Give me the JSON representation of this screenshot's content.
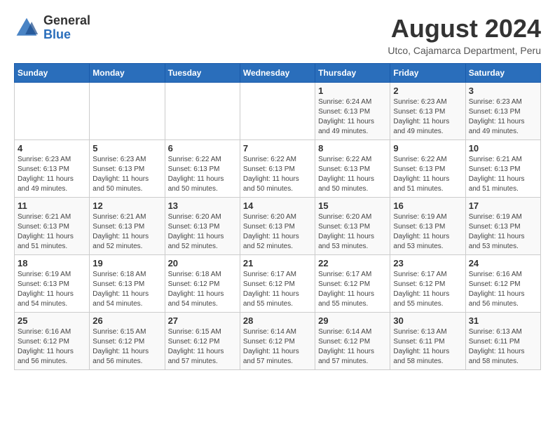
{
  "logo": {
    "general": "General",
    "blue": "Blue"
  },
  "title": "August 2024",
  "subtitle": "Utco, Cajamarca Department, Peru",
  "weekdays": [
    "Sunday",
    "Monday",
    "Tuesday",
    "Wednesday",
    "Thursday",
    "Friday",
    "Saturday"
  ],
  "weeks": [
    [
      {
        "day": "",
        "info": ""
      },
      {
        "day": "",
        "info": ""
      },
      {
        "day": "",
        "info": ""
      },
      {
        "day": "",
        "info": ""
      },
      {
        "day": "1",
        "info": "Sunrise: 6:24 AM\nSunset: 6:13 PM\nDaylight: 11 hours\nand 49 minutes."
      },
      {
        "day": "2",
        "info": "Sunrise: 6:23 AM\nSunset: 6:13 PM\nDaylight: 11 hours\nand 49 minutes."
      },
      {
        "day": "3",
        "info": "Sunrise: 6:23 AM\nSunset: 6:13 PM\nDaylight: 11 hours\nand 49 minutes."
      }
    ],
    [
      {
        "day": "4",
        "info": "Sunrise: 6:23 AM\nSunset: 6:13 PM\nDaylight: 11 hours\nand 49 minutes."
      },
      {
        "day": "5",
        "info": "Sunrise: 6:23 AM\nSunset: 6:13 PM\nDaylight: 11 hours\nand 50 minutes."
      },
      {
        "day": "6",
        "info": "Sunrise: 6:22 AM\nSunset: 6:13 PM\nDaylight: 11 hours\nand 50 minutes."
      },
      {
        "day": "7",
        "info": "Sunrise: 6:22 AM\nSunset: 6:13 PM\nDaylight: 11 hours\nand 50 minutes."
      },
      {
        "day": "8",
        "info": "Sunrise: 6:22 AM\nSunset: 6:13 PM\nDaylight: 11 hours\nand 50 minutes."
      },
      {
        "day": "9",
        "info": "Sunrise: 6:22 AM\nSunset: 6:13 PM\nDaylight: 11 hours\nand 51 minutes."
      },
      {
        "day": "10",
        "info": "Sunrise: 6:21 AM\nSunset: 6:13 PM\nDaylight: 11 hours\nand 51 minutes."
      }
    ],
    [
      {
        "day": "11",
        "info": "Sunrise: 6:21 AM\nSunset: 6:13 PM\nDaylight: 11 hours\nand 51 minutes."
      },
      {
        "day": "12",
        "info": "Sunrise: 6:21 AM\nSunset: 6:13 PM\nDaylight: 11 hours\nand 52 minutes."
      },
      {
        "day": "13",
        "info": "Sunrise: 6:20 AM\nSunset: 6:13 PM\nDaylight: 11 hours\nand 52 minutes."
      },
      {
        "day": "14",
        "info": "Sunrise: 6:20 AM\nSunset: 6:13 PM\nDaylight: 11 hours\nand 52 minutes."
      },
      {
        "day": "15",
        "info": "Sunrise: 6:20 AM\nSunset: 6:13 PM\nDaylight: 11 hours\nand 53 minutes."
      },
      {
        "day": "16",
        "info": "Sunrise: 6:19 AM\nSunset: 6:13 PM\nDaylight: 11 hours\nand 53 minutes."
      },
      {
        "day": "17",
        "info": "Sunrise: 6:19 AM\nSunset: 6:13 PM\nDaylight: 11 hours\nand 53 minutes."
      }
    ],
    [
      {
        "day": "18",
        "info": "Sunrise: 6:19 AM\nSunset: 6:13 PM\nDaylight: 11 hours\nand 54 minutes."
      },
      {
        "day": "19",
        "info": "Sunrise: 6:18 AM\nSunset: 6:13 PM\nDaylight: 11 hours\nand 54 minutes."
      },
      {
        "day": "20",
        "info": "Sunrise: 6:18 AM\nSunset: 6:12 PM\nDaylight: 11 hours\nand 54 minutes."
      },
      {
        "day": "21",
        "info": "Sunrise: 6:17 AM\nSunset: 6:12 PM\nDaylight: 11 hours\nand 55 minutes."
      },
      {
        "day": "22",
        "info": "Sunrise: 6:17 AM\nSunset: 6:12 PM\nDaylight: 11 hours\nand 55 minutes."
      },
      {
        "day": "23",
        "info": "Sunrise: 6:17 AM\nSunset: 6:12 PM\nDaylight: 11 hours\nand 55 minutes."
      },
      {
        "day": "24",
        "info": "Sunrise: 6:16 AM\nSunset: 6:12 PM\nDaylight: 11 hours\nand 56 minutes."
      }
    ],
    [
      {
        "day": "25",
        "info": "Sunrise: 6:16 AM\nSunset: 6:12 PM\nDaylight: 11 hours\nand 56 minutes."
      },
      {
        "day": "26",
        "info": "Sunrise: 6:15 AM\nSunset: 6:12 PM\nDaylight: 11 hours\nand 56 minutes."
      },
      {
        "day": "27",
        "info": "Sunrise: 6:15 AM\nSunset: 6:12 PM\nDaylight: 11 hours\nand 57 minutes."
      },
      {
        "day": "28",
        "info": "Sunrise: 6:14 AM\nSunset: 6:12 PM\nDaylight: 11 hours\nand 57 minutes."
      },
      {
        "day": "29",
        "info": "Sunrise: 6:14 AM\nSunset: 6:12 PM\nDaylight: 11 hours\nand 57 minutes."
      },
      {
        "day": "30",
        "info": "Sunrise: 6:13 AM\nSunset: 6:11 PM\nDaylight: 11 hours\nand 58 minutes."
      },
      {
        "day": "31",
        "info": "Sunrise: 6:13 AM\nSunset: 6:11 PM\nDaylight: 11 hours\nand 58 minutes."
      }
    ]
  ]
}
